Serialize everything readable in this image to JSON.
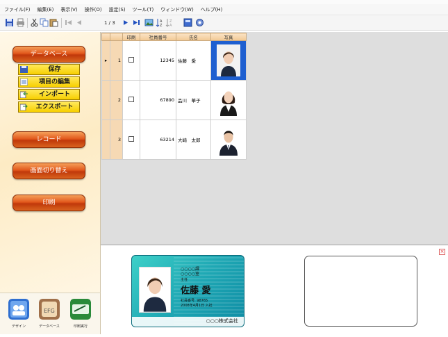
{
  "menu": [
    "ファイル(F)",
    "編集(E)",
    "表示(V)",
    "操作(O)",
    "設定(S)",
    "ツール(T)",
    "ウィンドウ(W)",
    "ヘルプ(H)"
  ],
  "toolbar": {
    "icons": [
      "save-icon",
      "print-icon",
      "cut-icon",
      "copy-icon",
      "paste-icon",
      "first-record-icon",
      "prev-record-icon",
      "next-record-icon",
      "last-record-icon",
      "image-icon",
      "sort-ascending-icon",
      "sort-descending-icon",
      "layout-icon",
      "refresh-icon"
    ],
    "pager": "1 / 3"
  },
  "sidebar": {
    "database_label": "データベース",
    "save_label": "保存",
    "edit_fields_label": "項目の編集",
    "import_label": "インポート",
    "export_label": "エクスポート",
    "record_label": "レコード",
    "switch_screen_label": "画面切り替え",
    "print_label": "印刷",
    "bottom": [
      {
        "icon": "design-icon",
        "label": "デザイン"
      },
      {
        "icon": "database-icon",
        "label": "データベース"
      },
      {
        "icon": "print-run-icon",
        "label": "印刷実行"
      }
    ]
  },
  "grid": {
    "headers": [
      "印刷",
      "社員番号",
      "氏名",
      "写真"
    ],
    "rows": [
      {
        "num": "1",
        "current_marker": "▸",
        "employee_no": "12345",
        "name": "佐藤　愛",
        "photo_selected": true
      },
      {
        "num": "2",
        "current_marker": "",
        "employee_no": "67890",
        "name": "品川　華子",
        "photo_selected": false
      },
      {
        "num": "3",
        "current_marker": "",
        "employee_no": "63214",
        "name": "大崎　太郎",
        "photo_selected": false
      }
    ]
  },
  "card": {
    "org1": "○○○○課",
    "org2": "○○○○室",
    "title": "主任",
    "name": "佐藤 愛",
    "employee_no": "社員番号: 98765",
    "joined": "2008年4月1日 入社",
    "company": "○○○株式会社",
    "accent": "#1fa8b4"
  },
  "colors": {
    "accent_red": "#e2581c",
    "button_yellow": "#f7cf00",
    "selection_blue": "#1e5fd0"
  }
}
